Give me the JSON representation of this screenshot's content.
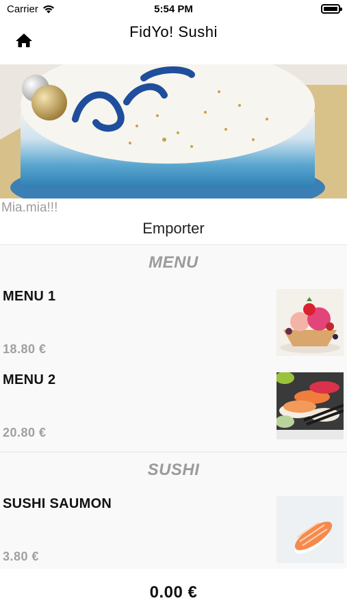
{
  "status_bar": {
    "carrier": "Carrier",
    "time": "5:54 PM",
    "wifi_icon": "wifi-icon",
    "battery_icon": "battery-icon"
  },
  "nav": {
    "title": "FidYo! Sushi",
    "home_icon": "home-icon"
  },
  "hero": {
    "image": "cake-photo"
  },
  "restaurant": {
    "name": "Mia.mia!!!",
    "mode": "Emporter"
  },
  "sections": [
    {
      "title": "MENU",
      "items": [
        {
          "name": "MENU 1",
          "price": "18.80 €",
          "image": "ice-cream-photo"
        },
        {
          "name": "MENU 2",
          "price": "20.80 €",
          "image": "sushi-platter-photo"
        }
      ]
    },
    {
      "title": "SUSHI",
      "items": [
        {
          "name": "SUSHI SAUMON",
          "price": "3.80 €",
          "image": "salmon-nigiri-photo"
        }
      ]
    }
  ],
  "footer": {
    "total": "0.00 €"
  },
  "colors": {
    "section_title": "#9b9b9b",
    "price": "#a0a0a0",
    "background": "#f9f9f9"
  }
}
